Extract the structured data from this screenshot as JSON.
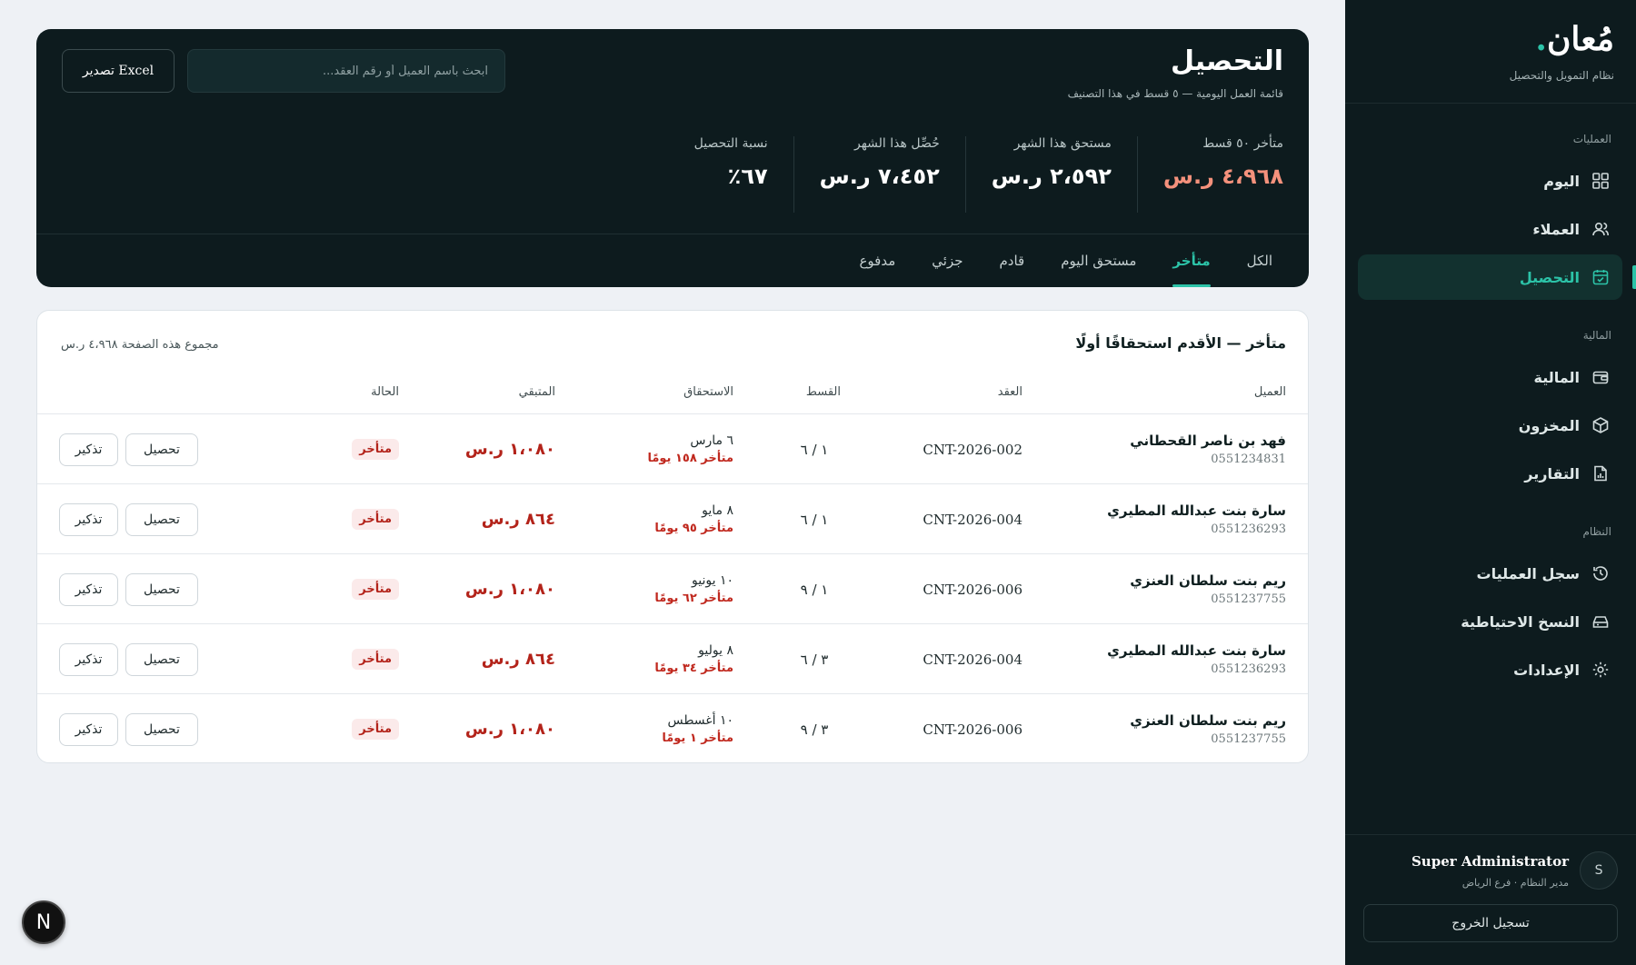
{
  "sidebar": {
    "logo": "مُعان",
    "logo_dot": ".",
    "tagline": "نظام التمويل والتحصيل",
    "sections": [
      {
        "title": "العمليات",
        "items": [
          {
            "label": "اليوم",
            "icon": "grid-icon"
          },
          {
            "label": "العملاء",
            "icon": "users-icon"
          },
          {
            "label": "التحصيل",
            "icon": "calendar-check-icon",
            "active": true
          }
        ]
      },
      {
        "title": "المالية",
        "items": [
          {
            "label": "المالية",
            "icon": "wallet-icon"
          },
          {
            "label": "المخزون",
            "icon": "box-icon"
          },
          {
            "label": "التقارير",
            "icon": "report-icon"
          }
        ]
      },
      {
        "title": "النظام",
        "items": [
          {
            "label": "سجل العمليات",
            "icon": "history-icon"
          },
          {
            "label": "النسخ الاحتياطية",
            "icon": "drive-icon"
          },
          {
            "label": "الإعدادات",
            "icon": "gear-icon"
          }
        ]
      }
    ],
    "user": {
      "initial": "S",
      "name": "Super Administrator",
      "role": "مدير النظام · فرع الرياض"
    },
    "logout_label": "تسجيل الخروج"
  },
  "header": {
    "title": "التحصيل",
    "subtitle": "قائمة العمل اليومية — ٥ قسط في هذا التصنيف",
    "search_placeholder": "ابحث باسم العميل أو رقم العقد...",
    "export_label": "تصدير Excel",
    "stats": [
      {
        "label": "متأخر ٥٠ قسط",
        "value": "٤،٩٦٨ ر.س",
        "overdue": true
      },
      {
        "label": "مستحق هذا الشهر",
        "value": "٢،٥٩٢ ر.س"
      },
      {
        "label": "حُصِّل هذا الشهر",
        "value": "٧،٤٥٢ ر.س"
      },
      {
        "label": "نسبة التحصيل",
        "value": "٦٧٪"
      }
    ],
    "tabs": [
      {
        "label": "الكل"
      },
      {
        "label": "متأخر",
        "active": true
      },
      {
        "label": "مستحق اليوم"
      },
      {
        "label": "قادم"
      },
      {
        "label": "جزئي"
      },
      {
        "label": "مدفوع"
      }
    ]
  },
  "table": {
    "title": "متأخر — الأقدم استحقاقًا أولًا",
    "page_total": "مجموع هذه الصفحة ٤،٩٦٨ ر.س",
    "columns": {
      "client": "العميل",
      "contract": "العقد",
      "installment": "القسط",
      "due": "الاستحقاق",
      "remaining": "المتبقي",
      "status": "الحالة"
    },
    "collect_label": "تحصيل",
    "remind_label": "تذكير",
    "rows": [
      {
        "name": "فهد بن ناصر القحطاني",
        "phone": "0551234831",
        "contract": "CNT-2026-002",
        "installment": "١ / ٦",
        "due_date": "٦ مارس",
        "late": "متأخر ١٥٨ يومًا",
        "remaining": "١،٠٨٠ ر.س",
        "status": "متأخر"
      },
      {
        "name": "سارة بنت عبدالله المطيري",
        "phone": "0551236293",
        "contract": "CNT-2026-004",
        "installment": "١ / ٦",
        "due_date": "٨ مايو",
        "late": "متأخر ٩٥ يومًا",
        "remaining": "٨٦٤ ر.س",
        "status": "متأخر"
      },
      {
        "name": "ريم بنت سلطان العنزي",
        "phone": "0551237755",
        "contract": "CNT-2026-006",
        "installment": "١ / ٩",
        "due_date": "١٠ يونيو",
        "late": "متأخر ٦٢ يومًا",
        "remaining": "١،٠٨٠ ر.س",
        "status": "متأخر"
      },
      {
        "name": "سارة بنت عبدالله المطيري",
        "phone": "0551236293",
        "contract": "CNT-2026-004",
        "installment": "٣ / ٦",
        "due_date": "٨ يوليو",
        "late": "متأخر ٣٤ يومًا",
        "remaining": "٨٦٤ ر.س",
        "status": "متأخر"
      },
      {
        "name": "ريم بنت سلطان العنزي",
        "phone": "0551237755",
        "contract": "CNT-2026-006",
        "installment": "٣ / ٩",
        "due_date": "١٠ أغسطس",
        "late": "متأخر ١ يومًا",
        "remaining": "١،٠٨٠ ر.س",
        "status": "متأخر"
      }
    ]
  },
  "fab_label": "N",
  "colors": {
    "accent": "#2cc3a8",
    "dark": "#0d1b1e",
    "overdue": "#b3231a",
    "overdue_stat": "#f4917c"
  }
}
